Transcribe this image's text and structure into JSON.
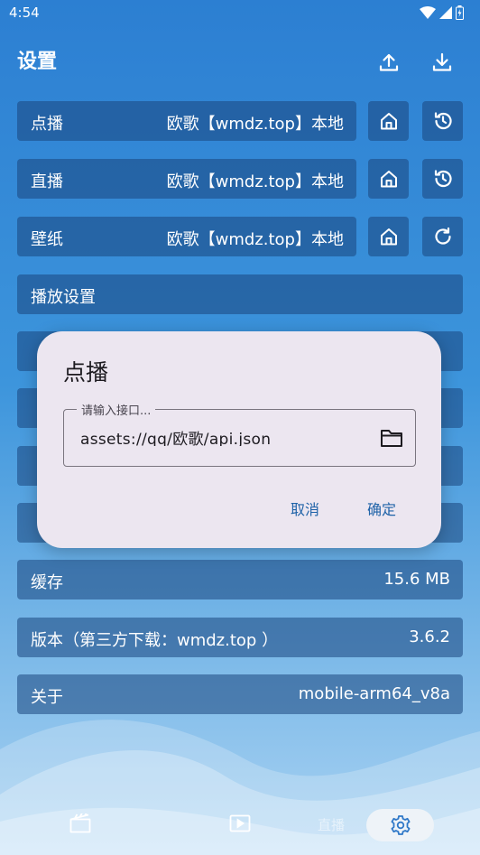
{
  "status_bar": {
    "time": "4:54"
  },
  "header": {
    "title": "设置",
    "upload_icon": "upload-icon",
    "download_icon": "download-icon"
  },
  "settings": {
    "vod": {
      "label": "点播",
      "value": "欧歌【wmdz.top】本地"
    },
    "live": {
      "label": "直播",
      "value": "欧歌【wmdz.top】本地"
    },
    "wallpaper": {
      "label": "壁纸",
      "value": "欧歌【wmdz.top】本地"
    },
    "playback": {
      "label": "播放设置"
    },
    "hidden_row_1": {
      "label": ""
    },
    "hidden_row_2": {
      "label": ""
    },
    "hidden_row_3": {
      "label": "",
      "value": ""
    },
    "hidden_row_4": {
      "label": ""
    },
    "cache": {
      "label": "缓存",
      "value": "15.6 MB"
    },
    "version": {
      "label": "版本（第三方下载：wmdz.top ）",
      "value": "3.6.2"
    },
    "about": {
      "label": "关于",
      "value": "mobile-arm64_v8a"
    }
  },
  "bottom_nav": {
    "items": [
      "film-icon",
      "play-icon",
      "settings-icon"
    ],
    "active": "settings-icon",
    "ghost_text": "直播"
  },
  "dialog": {
    "title": "点播",
    "field_label": "请输入接口...",
    "field_value": "assets://qq/欧歌/api.json",
    "cancel": "取消",
    "confirm": "确定"
  },
  "colors": {
    "background_top": "#2c7fd2",
    "row_bg": "rgba(25,70,125,0.55)",
    "dialog_bg": "#ece6f0",
    "dialog_button": "#1f63a8"
  }
}
